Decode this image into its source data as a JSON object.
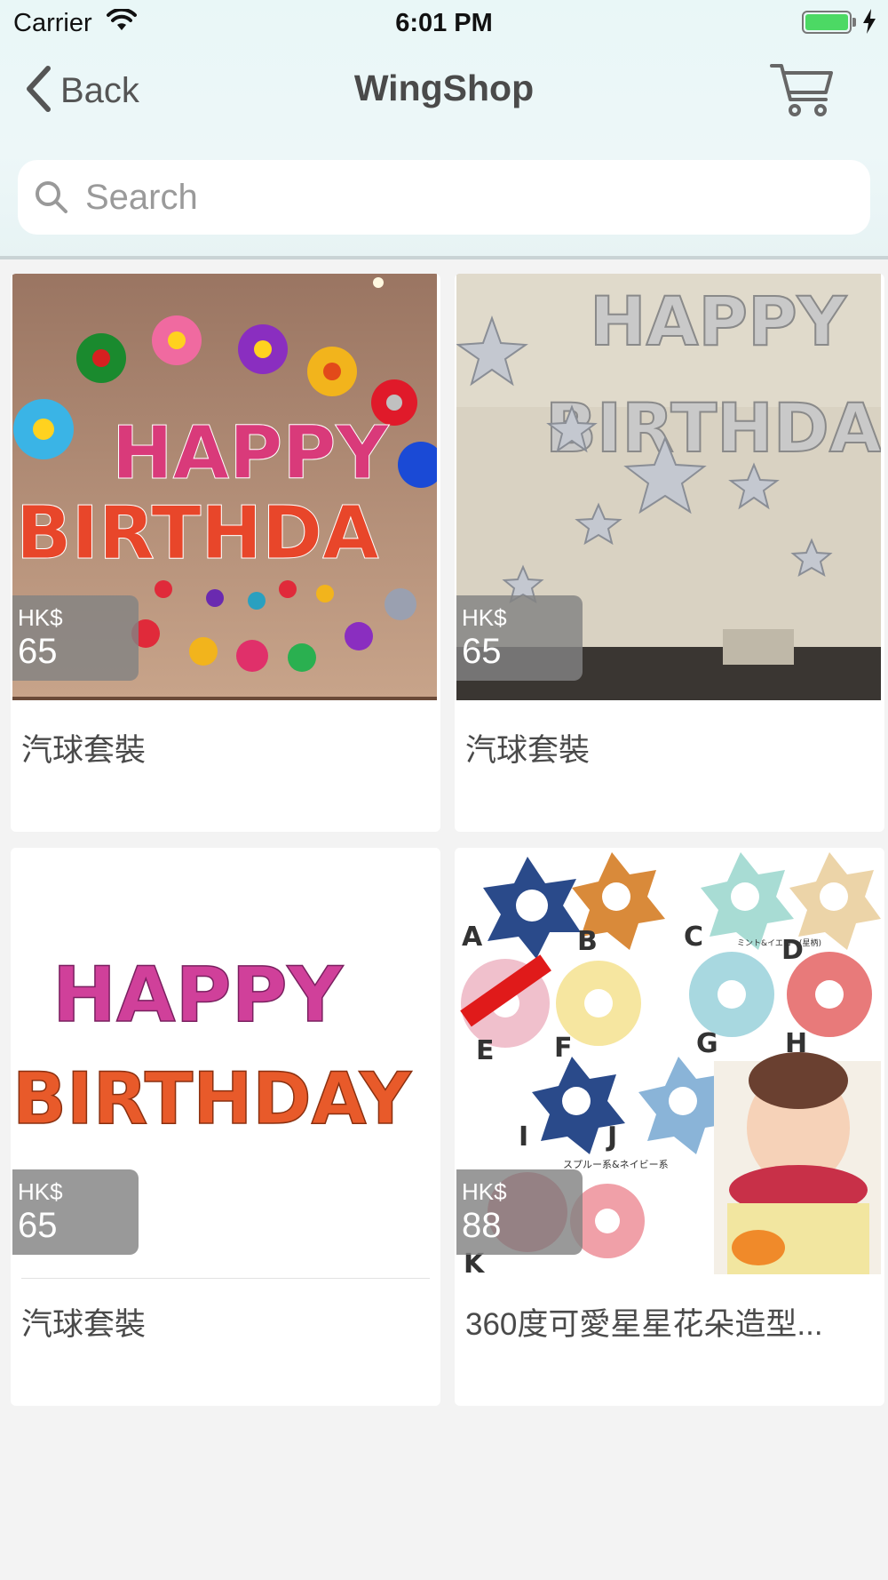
{
  "status_bar": {
    "carrier": "Carrier",
    "time": "6:01 PM",
    "battery_level": 1.0
  },
  "nav": {
    "back_label": "Back",
    "title": "WingShop",
    "cart_icon": "cart-icon",
    "back_icon": "chevron-left-icon"
  },
  "search": {
    "placeholder": "Search",
    "value": ""
  },
  "products": [
    {
      "name": "汽球套裝",
      "currency": "HK$",
      "price": "65",
      "image": "colorful happy birthday balloons with flowers"
    },
    {
      "name": "汽球套裝",
      "currency": "HK$",
      "price": "65",
      "image": "silver happy birthday balloons with stars"
    },
    {
      "name": "汽球套裝",
      "currency": "HK$",
      "price": "65",
      "image": "happy birthday letter balloons"
    },
    {
      "name": "360度可愛星星花朵造型...",
      "currency": "HK$",
      "price": "88",
      "image": "star and flower shaped baby bibs"
    }
  ],
  "image_text": {
    "banner_line1": "HAPPY",
    "banner_line2": "BIRTHDAY",
    "banner_line2_short": "BIRTHDA",
    "bib_letters": [
      "A",
      "B",
      "C",
      "D",
      "E",
      "F",
      "G",
      "H",
      "I",
      "J",
      "K"
    ],
    "bib_caption_1": "ミント&イエロー(星柄)",
    "bib_caption_2": "スプルー系&ネイビー系"
  },
  "colors": {
    "header_bg": "#e9f7f7",
    "page_bg": "#f3f3f3",
    "price_badge": "#828282",
    "battery": "#4cd964"
  }
}
